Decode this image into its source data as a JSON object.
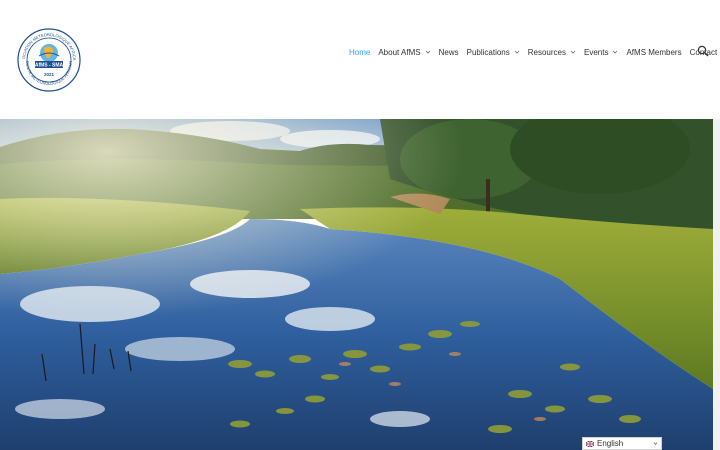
{
  "logo": {
    "ring_text_top": "ASSOCIATION METEOROLOGIQUE AFRICAINE",
    "name": "AfMS - SMA",
    "year": "2021",
    "ring_text_bottom": "SOCIETE METEOROLOGIQUE AFRICAINE"
  },
  "nav": {
    "items": [
      {
        "label": "Home",
        "active": true,
        "dropdown": false
      },
      {
        "label": "About AfMS",
        "active": false,
        "dropdown": true
      },
      {
        "label": "News",
        "active": false,
        "dropdown": false
      },
      {
        "label": "Publications",
        "active": false,
        "dropdown": true
      },
      {
        "label": "Resources",
        "active": false,
        "dropdown": true
      },
      {
        "label": "Events",
        "active": false,
        "dropdown": true
      },
      {
        "label": "AfMS Members",
        "active": false,
        "dropdown": false
      },
      {
        "label": "Contact",
        "active": false,
        "dropdown": false
      }
    ],
    "search_icon": "search-icon"
  },
  "language": {
    "selected": "English"
  },
  "colors": {
    "accent": "#2ea3f2",
    "text": "#333333"
  }
}
